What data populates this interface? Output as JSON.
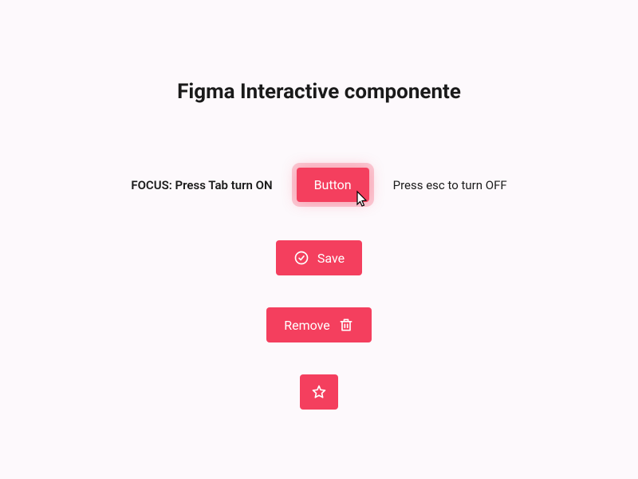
{
  "title": "Figma Interactive componente",
  "focus_row": {
    "hint_left": "FOCUS: Press Tab turn ON",
    "button_label": "Button",
    "hint_right": "Press esc to turn OFF"
  },
  "buttons": {
    "save_label": "Save",
    "remove_label": "Remove"
  },
  "colors": {
    "accent": "#f43f5e",
    "background": "#fdf9fc"
  },
  "icons": {
    "check_circle": "check-circle-icon",
    "trash": "trash-icon",
    "star": "star-icon",
    "cursor": "pointer-cursor-icon"
  }
}
